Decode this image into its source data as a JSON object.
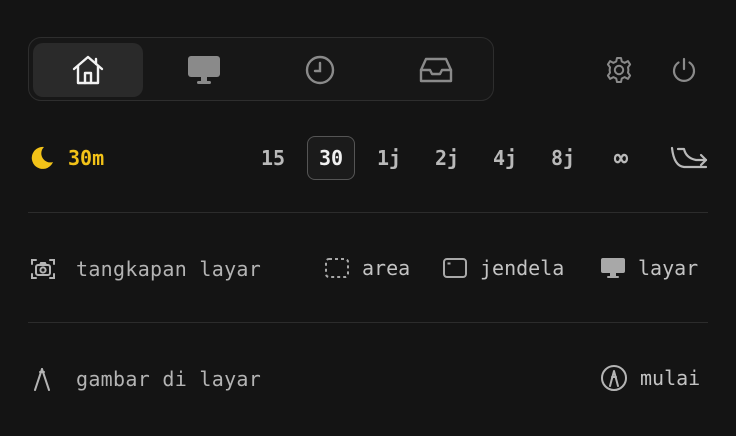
{
  "tabs": [
    {
      "name": "home",
      "icon": "home-icon",
      "active": true
    },
    {
      "name": "display",
      "icon": "monitor-icon",
      "active": false
    },
    {
      "name": "history",
      "icon": "clock-icon",
      "active": false
    },
    {
      "name": "inbox",
      "icon": "inbox-icon",
      "active": false
    }
  ],
  "header_icons": [
    "gear-icon",
    "power-icon"
  ],
  "timer": {
    "icon": "moon-icon",
    "value": "30m",
    "accent_color": "#f2c218",
    "durations": [
      "15",
      "30",
      "1j",
      "2j",
      "4j",
      "8j",
      "∞"
    ],
    "selected": "30",
    "trailing_icon": "auto-decline-icon"
  },
  "screenshot": {
    "icon": "camera-icon",
    "label": "tangkapan layar",
    "options": [
      {
        "icon": "dashed-rect-icon",
        "label": "area"
      },
      {
        "icon": "window-icon",
        "label": "jendela"
      },
      {
        "icon": "monitor-icon",
        "label": "layar"
      }
    ]
  },
  "draw": {
    "icon": "pen-nib-icon",
    "label": "gambar di layar",
    "action_icon": "circle-pen-icon",
    "action_label": "mulai"
  }
}
